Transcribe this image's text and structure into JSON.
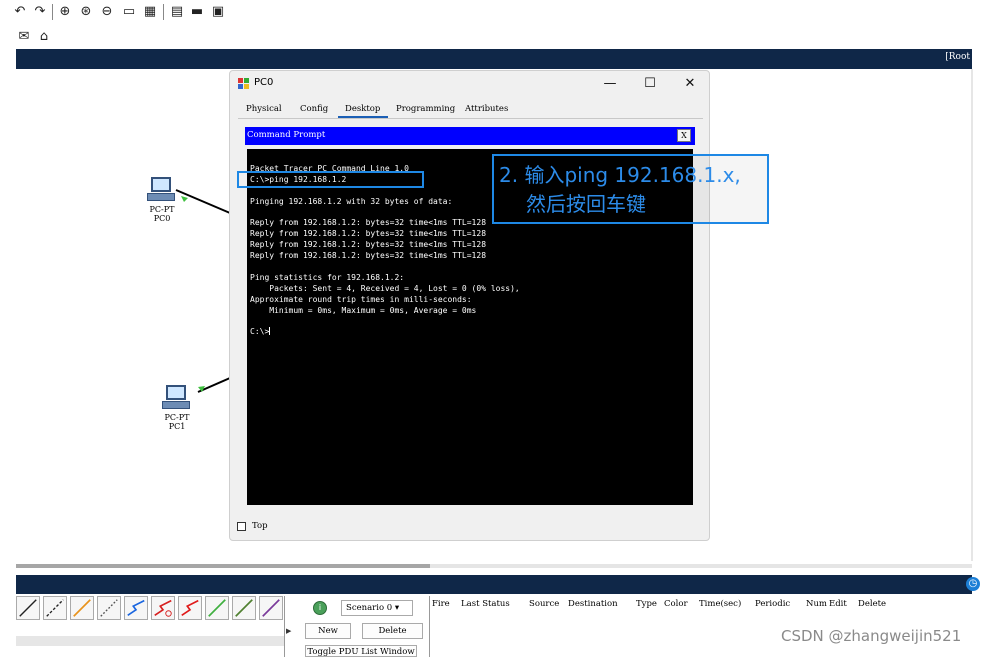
{
  "toolbar": {
    "icons": [
      "undo-icon",
      "redo-icon",
      "zoom-in-icon",
      "zoom-reset-icon",
      "zoom-out-icon",
      "rectangle-icon",
      "grid-icon",
      "note-icon",
      "palette-icon",
      "image-icon"
    ],
    "icons2": [
      "mail-icon",
      "open-mail-icon"
    ]
  },
  "topbar": {
    "root_label": "[Root"
  },
  "workspace": {
    "pc0": {
      "line1": "PC-PT",
      "line2": "PC0"
    },
    "pc1": {
      "line1": "PC-PT",
      "line2": "PC1"
    }
  },
  "window": {
    "title": "PC0",
    "minimize": "—",
    "maximize": "☐",
    "close": "✕",
    "tabs": [
      "Physical",
      "Config",
      "Desktop",
      "Programming",
      "Attributes"
    ],
    "active_tab": "Desktop",
    "command_prompt": {
      "title": "Command Prompt",
      "close": "X",
      "lines": [
        "Packet Tracer PC Command Line 1.0",
        "C:\\>ping 192.168.1.2",
        "",
        "Pinging 192.168.1.2 with 32 bytes of data:",
        "",
        "Reply from 192.168.1.2: bytes=32 time<1ms TTL=128",
        "Reply from 192.168.1.2: bytes=32 time<1ms TTL=128",
        "Reply from 192.168.1.2: bytes=32 time<1ms TTL=128",
        "Reply from 192.168.1.2: bytes=32 time<1ms TTL=128",
        "",
        "Ping statistics for 192.168.1.2:",
        "    Packets: Sent = 4, Received = 4, Lost = 0 (0% loss),",
        "Approximate round trip times in milli-seconds:",
        "    Minimum = 0ms, Maximum = 0ms, Average = 0ms",
        "",
        "C:\\>"
      ]
    },
    "top_checkbox_label": "Top"
  },
  "annotation": {
    "line1": "2. 输入ping 192.168.1.x,",
    "line2": "然后按回车键"
  },
  "bottom": {
    "scenario_label": "Scenario 0",
    "new_button": "New",
    "delete_button": "Delete",
    "toggle_button": "Toggle PDU List Window",
    "pdu_columns": [
      "Fire",
      "Last Status",
      "Source",
      "Destination",
      "Type",
      "Color",
      "Time(sec)",
      "Periodic",
      "Num",
      "Edit",
      "Delete"
    ],
    "link_colors": [
      "#222222",
      "#222222",
      "#e8931c",
      "#555555",
      "#1a66e0",
      "#d62020",
      "#e01a1a",
      "#40b040",
      "#508030",
      "#7a3a9a"
    ]
  },
  "watermark": "CSDN @zhangweijin521"
}
